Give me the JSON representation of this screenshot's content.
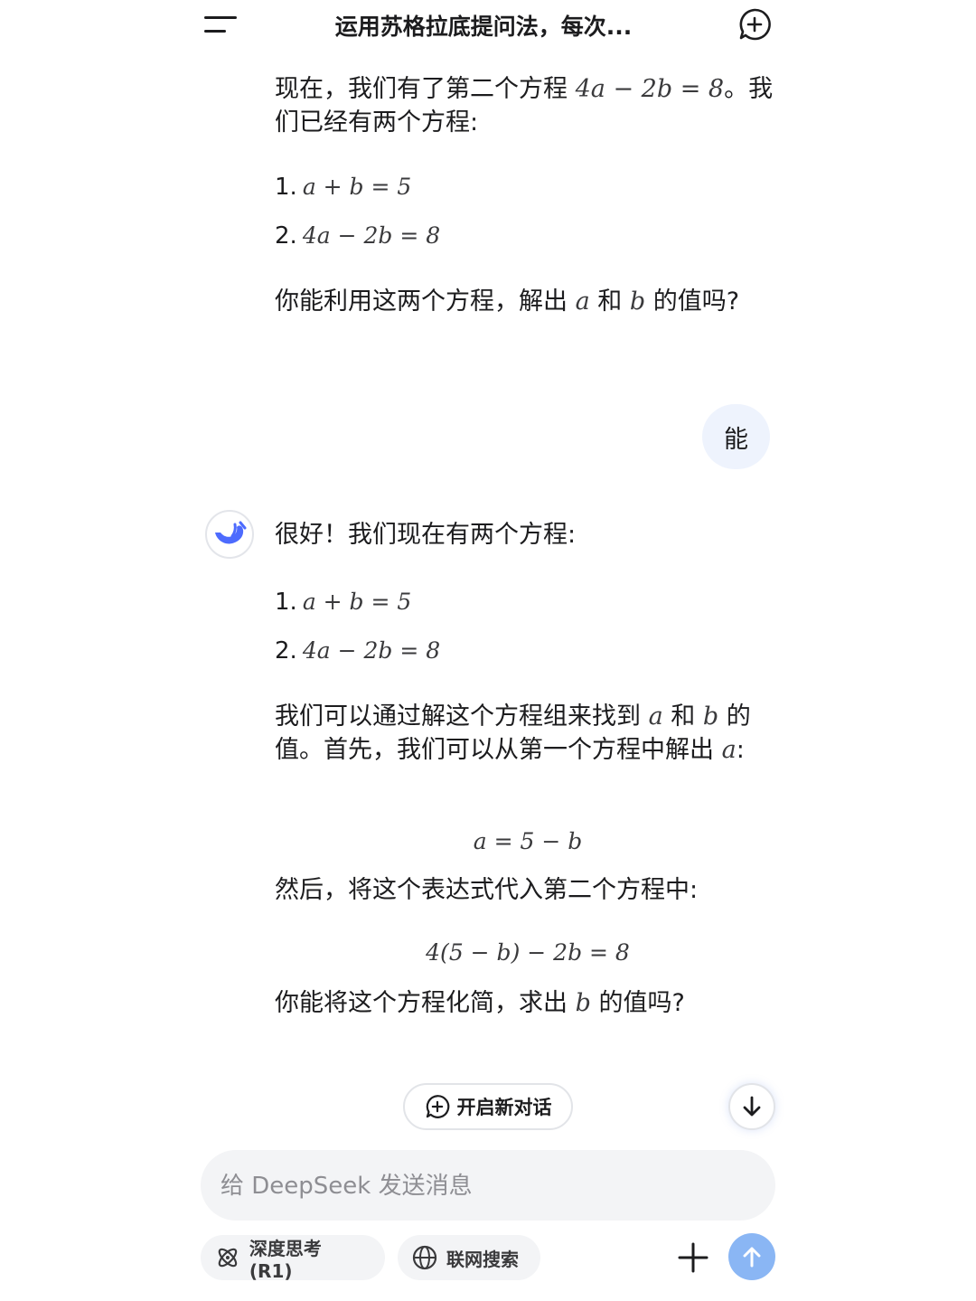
{
  "header": {
    "title": "运用苏格拉底提问法，每次...",
    "menu_icon": "menu-icon",
    "new_chat_icon": "new-chat-icon"
  },
  "assistant_1": {
    "intro_a": "现在，我们有了第二个方程 ",
    "intro_math": "4a − 2b = 8",
    "intro_b": "。我们已经有两个方程:",
    "eq1_num": "1.",
    "eq1": "a + b = 5",
    "eq2_num": "2.",
    "eq2": "4a − 2b = 8",
    "question_a": "你能利用这两个方程，解出 ",
    "question_var_a": "a",
    "question_and": " 和 ",
    "question_var_b": "b",
    "question_b": " 的值吗?"
  },
  "user_message": "能",
  "assistant_2": {
    "avatar_icon": "deepseek-whale-icon",
    "intro": "很好！我们现在有两个方程:",
    "eq1_num": "1.",
    "eq1": "a + b = 5",
    "eq2_num": "2.",
    "eq2": "4a − 2b = 8",
    "para_a": "我们可以通过解这个方程组来找到 ",
    "para_var_a": "a",
    "para_and": " 和 ",
    "para_var_b": "b",
    "para_b": " 的值。首先，我们可以从第一个方程中解出 ",
    "para_var_a2": "a",
    "para_c": ":",
    "display1": "a = 5 − b",
    "para2": "然后，将这个表达式代入第二个方程中:",
    "display2": "4(5 − b) − 2b = 8",
    "question_a": "你能将这个方程化简，求出 ",
    "question_var_b": "b",
    "question_b": " 的值吗?"
  },
  "new_chat_button": "开启新对话",
  "input": {
    "placeholder": "给 DeepSeek 发送消息",
    "value": ""
  },
  "toolbar": {
    "deep_think_label": "深度思考 (R1)",
    "web_search_label": "联网搜索"
  },
  "colors": {
    "accent": "#4d6bfe",
    "send_button": "#8ab6f4",
    "bubble": "#eef3fd"
  }
}
